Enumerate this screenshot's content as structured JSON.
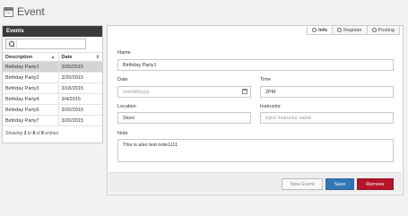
{
  "app": {
    "title": "Event",
    "icon": "calendar-icon"
  },
  "events_panel": {
    "title": "Events",
    "search": {
      "value": "",
      "placeholder": "",
      "icon": "search-icon"
    },
    "columns": [
      "Description",
      "Date"
    ],
    "rows": [
      {
        "description": "Birthday Party1",
        "date": "3/20/2015",
        "selected": true
      },
      {
        "description": "Birthday Party2",
        "date": "3/20/2015"
      },
      {
        "description": "Birthday Party3",
        "date": "3/18/2015"
      },
      {
        "description": "Birthday Party4",
        "date": "3/4/2015"
      },
      {
        "description": "Birthday Party6",
        "date": "3/20/2015"
      },
      {
        "description": "Birthday Party7",
        "date": "3/20/2015"
      }
    ],
    "info": {
      "prefix": "Showing ",
      "from": "1",
      "mid1": " to ",
      "to": "6",
      "mid2": " of ",
      "total": "6",
      "suffix": " entries"
    }
  },
  "tabs": [
    {
      "label": "Info",
      "icon": "info-icon",
      "active": true
    },
    {
      "label": "Register",
      "icon": "register-icon"
    },
    {
      "label": "Posting",
      "icon": "posting-icon"
    }
  ],
  "form": {
    "name": {
      "label": "Name",
      "value": "Birthday Party1"
    },
    "date": {
      "label": "Date",
      "value": "",
      "placeholder": "mm/dd/yyyy"
    },
    "time": {
      "label": "Time",
      "value": "2PM"
    },
    "location": {
      "label": "Location",
      "value": "Store"
    },
    "instructor": {
      "label": "Instructor",
      "value": "",
      "placeholder": "input instructor name"
    },
    "note": {
      "label": "Note",
      "value": "This is also test note1111"
    }
  },
  "buttons": {
    "new": "New Event",
    "save": "Save",
    "remove": "Remove"
  },
  "colors": {
    "save": "#3277b6",
    "remove": "#b5142b",
    "header": "#3a3a3a",
    "selected_row": "#d4d4d4"
  }
}
